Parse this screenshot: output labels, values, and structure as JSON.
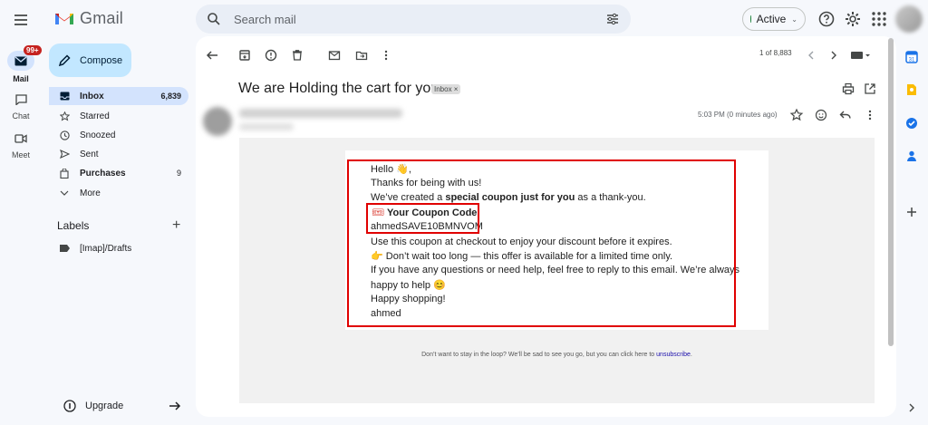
{
  "app": {
    "name": "Gmail"
  },
  "search": {
    "placeholder": "Search mail"
  },
  "status": {
    "label": "Active"
  },
  "rail": {
    "mail": {
      "label": "Mail",
      "badge": "99+"
    },
    "chat": {
      "label": "Chat"
    },
    "meet": {
      "label": "Meet"
    }
  },
  "compose": {
    "label": "Compose"
  },
  "nav": [
    {
      "label": "Inbox",
      "count": "6,839"
    },
    {
      "label": "Starred",
      "count": ""
    },
    {
      "label": "Snoozed",
      "count": ""
    },
    {
      "label": "Sent",
      "count": ""
    },
    {
      "label": "Purchases",
      "count": "9"
    },
    {
      "label": "More",
      "count": ""
    }
  ],
  "labels": {
    "heading": "Labels",
    "items": [
      "[Imap]/Drafts"
    ]
  },
  "upgrade": {
    "label": "Upgrade"
  },
  "toolbar": {
    "page_count": "1 of 8,883"
  },
  "message": {
    "subject": "We are Holding the cart for you",
    "chip": "Inbox ×",
    "timestamp": "5:03 PM (0 minutes ago)",
    "body": {
      "greeting": "Hello 👋,",
      "thanks": "Thanks for being with us!",
      "created_pre": "We’ve created a ",
      "created_bold": "special coupon just for you",
      "created_post": " as a thank-you.",
      "coupon_label": "Your Coupon Code:",
      "coupon_code": "ahmedSAVE10BMNVOM",
      "use": "Use this coupon at checkout to enjoy your discount before it expires.",
      "dont_wait": "Don’t wait too long — this offer is available for a limited time only.",
      "questions": "If you have any questions or need help, feel free to reply to this email. We’re always",
      "happy_help": "happy to help",
      "happy_shopping": "Happy shopping!",
      "signoff": "ahmed"
    },
    "footer_text": "Don’t want to stay in the loop? We’ll be sad to see you go, but you can click here to ",
    "footer_link": "unsubscribe",
    "footer_end": "."
  },
  "colors": {
    "accent": "#c2e7ff",
    "active_nav": "#d3e3fd",
    "highlight": "#e00000"
  }
}
